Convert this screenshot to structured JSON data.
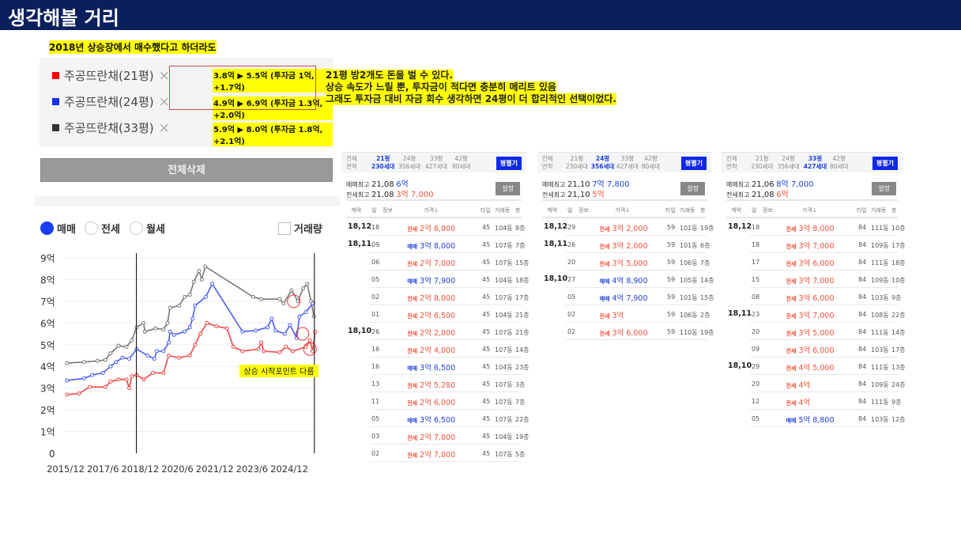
{
  "header": {
    "title": "생각해볼 거리"
  },
  "subtitle": "2018년 상승장에서 매수했다고 하더라도",
  "legend": [
    {
      "label": "주공뜨란채(21평)",
      "color": "#ff0000",
      "note": "3.8억 ▶ 5.5억 (투자금 1억, +1.7억)"
    },
    {
      "label": "주공뜨란채(24평)",
      "color": "#1a2cff",
      "note": "4.9억 ▶ 6.9억 (투자금 1.3억, +2.0억)"
    },
    {
      "label": "주공뜨란채(33평)",
      "color": "#333333",
      "note": "5.9억 ▶ 8.0억 (투자금 1.8억, +2.1억)"
    }
  ],
  "remove_symbol": "×",
  "message": [
    "21평 방2개도 돈을 벌 수 있다.",
    "상승 속도가 느릴 뿐, 투자금이 적다면 충분히 메리트 있음",
    "그래도 투자금 대비 자금 회수 생각하면 24평이 더 합리적인 선택이었다."
  ],
  "delete_all": "전체삭제",
  "radios": [
    {
      "label": "매매",
      "checked": true
    },
    {
      "label": "전세",
      "checked": false
    },
    {
      "label": "월세",
      "checked": false
    }
  ],
  "volume_checkbox": {
    "label": "거래량",
    "checked": false
  },
  "chart_data": {
    "type": "line",
    "yticks": [
      "0",
      "1억",
      "2억",
      "3억",
      "4억",
      "5억",
      "6억",
      "7억",
      "8억",
      "9억"
    ],
    "ylim": [
      0,
      9
    ],
    "xlim": [
      2015.92,
      2026.0
    ],
    "xticks": [
      {
        "label": "2015/12",
        "x": 2015.92
      },
      {
        "label": "2017/6",
        "x": 2017.42
      },
      {
        "label": "2018/12",
        "x": 2018.92
      },
      {
        "label": "2020/6",
        "x": 2020.42
      },
      {
        "label": "2021/12",
        "x": 2021.92
      },
      {
        "label": "2023/6",
        "x": 2023.42
      },
      {
        "label": "2024/12",
        "x": 2024.92
      }
    ],
    "vlines": [
      2018.77,
      2025.93
    ],
    "annotation": "상승 시작포인트 다름",
    "circles": [
      {
        "x": 2025.1,
        "y": 7.0,
        "series": "33평"
      },
      {
        "x": 2025.45,
        "y": 5.5,
        "series": "24평"
      },
      {
        "x": 2025.75,
        "y": 4.8,
        "series": "21평"
      }
    ],
    "series": [
      {
        "name": "33평",
        "color": "#777777",
        "points": [
          [
            2015.98,
            4.15
          ],
          [
            2016.67,
            4.2
          ],
          [
            2017.2,
            4.25
          ],
          [
            2017.52,
            4.3
          ],
          [
            2017.73,
            4.6
          ],
          [
            2018.05,
            4.95
          ],
          [
            2018.37,
            4.9
          ],
          [
            2018.58,
            5.2
          ],
          [
            2018.78,
            5.8
          ],
          [
            2019.06,
            6.0
          ],
          [
            2019.11,
            5.6
          ],
          [
            2019.54,
            5.75
          ],
          [
            2019.86,
            5.7
          ],
          [
            2020.02,
            6.0
          ],
          [
            2020.12,
            6.7
          ],
          [
            2020.49,
            6.8
          ],
          [
            2020.71,
            7.2
          ],
          [
            2020.92,
            7.3
          ],
          [
            2021.08,
            7.9
          ],
          [
            2021.29,
            8.4
          ],
          [
            2021.4,
            8.0
          ],
          [
            2021.54,
            8.6
          ],
          [
            2023.47,
            7.2
          ],
          [
            2023.79,
            7.1
          ],
          [
            2024.53,
            7.1
          ],
          [
            2024.69,
            6.9
          ],
          [
            2025.01,
            7.5
          ],
          [
            2025.27,
            7.0
          ],
          [
            2025.48,
            7.6
          ],
          [
            2025.64,
            7.8
          ],
          [
            2025.8,
            7.0
          ],
          [
            2025.91,
            6.3
          ]
        ]
      },
      {
        "name": "24평",
        "color": "#4a5cf0",
        "points": [
          [
            2015.98,
            3.35
          ],
          [
            2016.67,
            3.45
          ],
          [
            2016.99,
            3.6
          ],
          [
            2017.42,
            3.7
          ],
          [
            2017.73,
            4.0
          ],
          [
            2017.95,
            4.2
          ],
          [
            2018.21,
            4.4
          ],
          [
            2018.48,
            4.35
          ],
          [
            2018.78,
            4.8
          ],
          [
            2019.22,
            4.5
          ],
          [
            2019.49,
            4.35
          ],
          [
            2019.59,
            4.7
          ],
          [
            2019.86,
            4.7
          ],
          [
            2020.07,
            5.1
          ],
          [
            2020.12,
            5.6
          ],
          [
            2020.28,
            5.45
          ],
          [
            2020.71,
            5.6
          ],
          [
            2020.92,
            5.8
          ],
          [
            2021.03,
            6.2
          ],
          [
            2021.13,
            6.8
          ],
          [
            2021.56,
            7.2
          ],
          [
            2021.82,
            7.8
          ],
          [
            2023.04,
            5.6
          ],
          [
            2023.57,
            5.65
          ],
          [
            2024.05,
            5.8
          ],
          [
            2024.21,
            6.2
          ],
          [
            2024.37,
            5.65
          ],
          [
            2024.74,
            5.5
          ],
          [
            2024.95,
            5.9
          ],
          [
            2025.22,
            5.3
          ],
          [
            2025.33,
            6.3
          ],
          [
            2025.59,
            6.5
          ],
          [
            2025.86,
            6.9
          ]
        ]
      },
      {
        "name": "21평",
        "color": "#f04545",
        "points": [
          [
            2015.98,
            2.7
          ],
          [
            2016.46,
            2.75
          ],
          [
            2016.89,
            3.05
          ],
          [
            2017.52,
            3.05
          ],
          [
            2017.73,
            3.3
          ],
          [
            2018.05,
            3.4
          ],
          [
            2018.37,
            3.4
          ],
          [
            2018.48,
            3.0
          ],
          [
            2018.58,
            3.55
          ],
          [
            2018.78,
            3.6
          ],
          [
            2019.06,
            3.4
          ],
          [
            2019.43,
            3.7
          ],
          [
            2019.86,
            3.7
          ],
          [
            2020.07,
            4.5
          ],
          [
            2020.49,
            4.4
          ],
          [
            2020.92,
            4.5
          ],
          [
            2021.13,
            5.0
          ],
          [
            2021.34,
            5.5
          ],
          [
            2021.61,
            6.0
          ],
          [
            2021.98,
            5.85
          ],
          [
            2022.41,
            5.75
          ],
          [
            2022.67,
            4.9
          ],
          [
            2023.04,
            4.7
          ],
          [
            2023.68,
            4.8
          ],
          [
            2023.79,
            5.1
          ],
          [
            2023.89,
            4.7
          ],
          [
            2024.53,
            4.65
          ],
          [
            2024.79,
            4.9
          ],
          [
            2025.06,
            4.7
          ],
          [
            2025.59,
            4.9
          ],
          [
            2025.75,
            5.2
          ],
          [
            2025.86,
            4.7
          ],
          [
            2025.96,
            5.6
          ]
        ]
      }
    ]
  },
  "panels": [
    {
      "tabs": [
        [
          "전체",
          "면적"
        ],
        [
          "21평",
          "230세대"
        ],
        [
          "24평",
          "356세대"
        ],
        [
          "33평",
          "427세대"
        ],
        [
          "42평",
          "80세대"
        ]
      ],
      "active": 1,
      "expand": "평펼기",
      "sale_max": {
        "label": "매매최고",
        "date": "21,08",
        "value": "6억"
      },
      "jeonse_max": {
        "label": "전세최고",
        "date": "21,08",
        "value": "3억 7,000"
      },
      "settings": "설정",
      "rows": [
        [
          "18,12",
          "18",
          "전세",
          "2억 6,000",
          "45",
          "104동",
          "8층"
        ],
        [
          "18,11",
          "09",
          "매매",
          "3억 8,000",
          "45",
          "107동",
          "7층"
        ],
        [
          "",
          "06",
          "전세",
          "2억 7,000",
          "45",
          "107동",
          "15층"
        ],
        [
          "",
          "05",
          "매매",
          "3억 7,900",
          "45",
          "104동",
          "18층"
        ],
        [
          "",
          "02",
          "전세",
          "2억 8,000",
          "45",
          "107동",
          "17층"
        ],
        [
          "",
          "01",
          "전세",
          "2억 6,500",
          "45",
          "104동",
          "21층"
        ],
        [
          "18,10",
          "26",
          "전세",
          "2억 2,000",
          "45",
          "107동",
          "21층"
        ],
        [
          "",
          "16",
          "전세",
          "2억 4,000",
          "45",
          "107동",
          "14층"
        ],
        [
          "",
          "16",
          "매매",
          "3억 6,500",
          "45",
          "104동",
          "23층"
        ],
        [
          "",
          "13",
          "전세",
          "2억 5,280",
          "45",
          "107동",
          "3층"
        ],
        [
          "",
          "11",
          "전세",
          "2억 6,000",
          "45",
          "107동",
          "7층"
        ],
        [
          "",
          "05",
          "매매",
          "3억 6,500",
          "45",
          "107동",
          "22층"
        ],
        [
          "",
          "03",
          "전세",
          "2억 7,000",
          "45",
          "104동",
          "19층"
        ],
        [
          "",
          "02",
          "전세",
          "2억 7,000",
          "45",
          "107동",
          "5층"
        ]
      ]
    },
    {
      "tabs": [
        [
          "전체",
          "면적"
        ],
        [
          "21평",
          "230세대"
        ],
        [
          "24평",
          "356세대"
        ],
        [
          "33평",
          "427세대"
        ],
        [
          "42평",
          "80세대"
        ]
      ],
      "active": 2,
      "expand": "평펼기",
      "sale_max": {
        "label": "매매최고",
        "date": "21,10",
        "value": "7억 7,800"
      },
      "jeonse_max": {
        "label": "전세최고",
        "date": "21,10",
        "value": "5억"
      },
      "settings": "설정",
      "rows": [
        [
          "18,12",
          "29",
          "전세",
          "3억 2,000",
          "59",
          "101동",
          "19층"
        ],
        [
          "18,11",
          "26",
          "전세",
          "3억 2,000",
          "59",
          "101동",
          "6층"
        ],
        [
          "",
          "20",
          "전세",
          "3억 5,000",
          "59",
          "106동",
          "7층"
        ],
        [
          "18,10",
          "27",
          "매매",
          "4억 8,900",
          "59",
          "105동",
          "14층"
        ],
        [
          "",
          "05",
          "매매",
          "4억 7,900",
          "59",
          "101동",
          "15층"
        ],
        [
          "",
          "02",
          "전세",
          "3억",
          "59",
          "106동",
          "2층"
        ],
        [
          "",
          "02",
          "전세",
          "3억 6,000",
          "59",
          "110동",
          "19층"
        ]
      ]
    },
    {
      "tabs": [
        [
          "전체",
          "면적"
        ],
        [
          "21평",
          "230세대"
        ],
        [
          "24평",
          "356세대"
        ],
        [
          "33평",
          "427세대"
        ],
        [
          "42평",
          "80세대"
        ]
      ],
      "active": 3,
      "expand": "평펼기",
      "sale_max": {
        "label": "매매최고",
        "date": "21,06",
        "value": "8억 7,000"
      },
      "jeonse_max": {
        "label": "전세최고",
        "date": "21,08",
        "value": "6억"
      },
      "settings": "설정",
      "rows": [
        [
          "18,12",
          "18",
          "전세",
          "3억 8,000",
          "84",
          "111동",
          "10층"
        ],
        [
          "",
          "18",
          "전세",
          "3억 7,000",
          "84",
          "109동",
          "17층"
        ],
        [
          "",
          "17",
          "전세",
          "3억 6,000",
          "84",
          "111동",
          "18층"
        ],
        [
          "",
          "15",
          "전세",
          "3억 7,000",
          "84",
          "109동",
          "10층"
        ],
        [
          "",
          "08",
          "전세",
          "3억 6,000",
          "84",
          "103동",
          "9층"
        ],
        [
          "18,11",
          "23",
          "전세",
          "3억 7,000",
          "84",
          "108동",
          "22층"
        ],
        [
          "",
          "20",
          "전세",
          "3억 5,000",
          "84",
          "111동",
          "14층"
        ],
        [
          "",
          "09",
          "전세",
          "3억 6,000",
          "84",
          "103동",
          "17층"
        ],
        [
          "18,10",
          "29",
          "전세",
          "4억 5,000",
          "84",
          "111동",
          "13층"
        ],
        [
          "",
          "20",
          "전세",
          "4억",
          "84",
          "109동",
          "24층"
        ],
        [
          "",
          "12",
          "전세",
          "4억",
          "84",
          "111동",
          "9층"
        ],
        [
          "",
          "05",
          "매매",
          "5억 8,800",
          "84",
          "103동",
          "12층"
        ]
      ]
    }
  ],
  "table_headers": [
    "계약",
    "일",
    "정보",
    "가격↓",
    "타입",
    "거래동",
    "층"
  ]
}
